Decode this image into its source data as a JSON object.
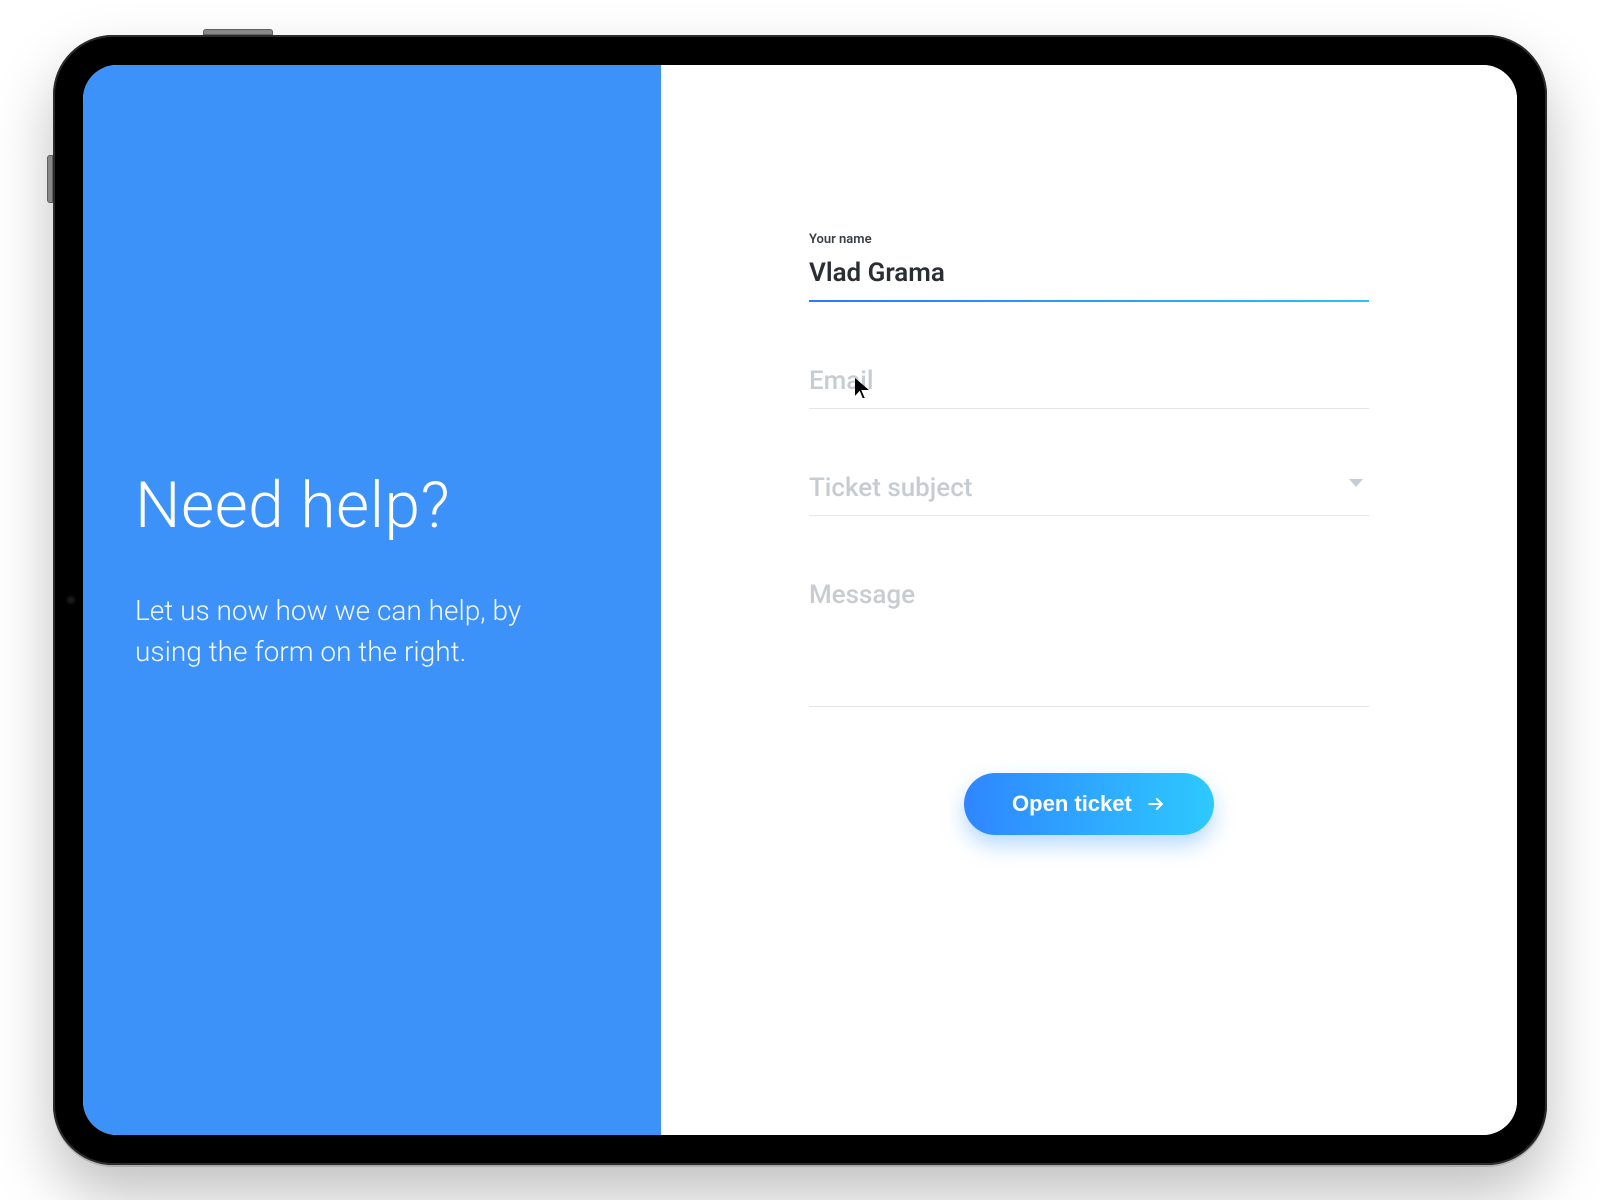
{
  "colors": {
    "panel_blue": "#3d92fa",
    "gradient_start": "#2f86ff",
    "gradient_end": "#2dc9ff"
  },
  "left": {
    "title": "Need help?",
    "subtitle": "Let us now how we can help, by using the form on the right."
  },
  "form": {
    "name": {
      "label": "Your name",
      "value": "Vlad Grama",
      "placeholder": "Your name"
    },
    "email": {
      "placeholder": "Email",
      "value": ""
    },
    "subject": {
      "placeholder": "Ticket subject",
      "selected": ""
    },
    "message": {
      "placeholder": "Message",
      "value": ""
    },
    "submit_label": "Open ticket"
  }
}
